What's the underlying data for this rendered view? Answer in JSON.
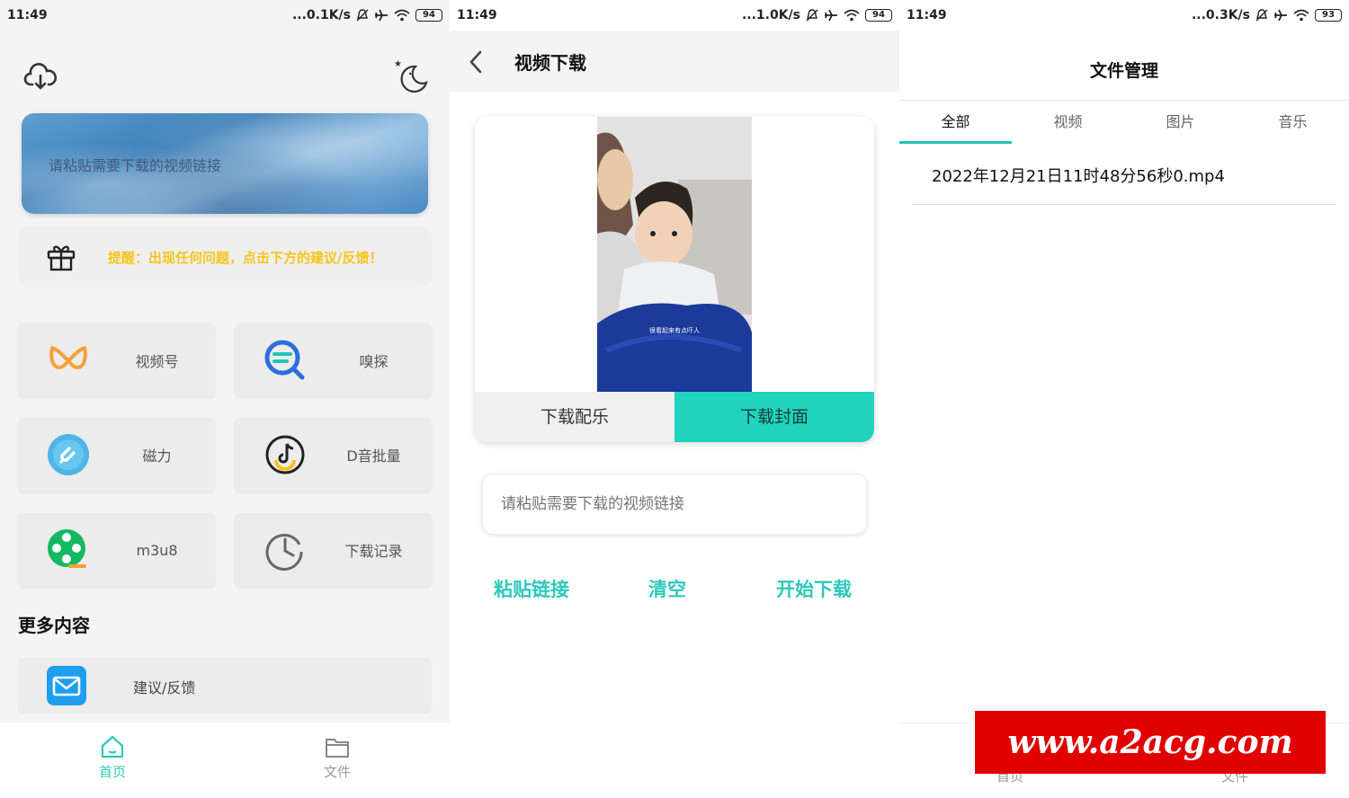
{
  "status": [
    {
      "time": "11:49",
      "speed": "...0.1K/s",
      "battery": "94"
    },
    {
      "time": "11:49",
      "speed": "...1.0K/s",
      "battery": "94"
    },
    {
      "time": "11:49",
      "speed": "...0.3K/s",
      "battery": "93"
    }
  ],
  "home": {
    "banner_placeholder": "请粘贴需要下载的视频链接",
    "tip": "提醒：出现任何问题，点击下方的建议/反馈！",
    "tiles": [
      {
        "label": "视频号",
        "icon": "wave-logo-icon"
      },
      {
        "label": "嗅探",
        "icon": "search-icon"
      },
      {
        "label": "磁力",
        "icon": "magnet-icon"
      },
      {
        "label": "D音批量",
        "icon": "music-note-icon"
      },
      {
        "label": "m3u8",
        "icon": "film-reel-icon"
      },
      {
        "label": "下载记录",
        "icon": "clock-icon"
      }
    ],
    "more_title": "更多内容",
    "feedback_label": "建议/反馈",
    "nav": {
      "home": "首页",
      "files": "文件"
    },
    "accent": "#2cc9bb",
    "tip_color": "#f5c518"
  },
  "download": {
    "title": "视频下载",
    "video_caption": "很看起来有点吓人",
    "download_music": "下载配乐",
    "download_cover": "下载封面",
    "input_placeholder": "请粘贴需要下载的视频链接",
    "paste": "粘贴链接",
    "clear": "清空",
    "start": "开始下载",
    "cover_color": "#20d4c0"
  },
  "files": {
    "title": "文件管理",
    "tabs": [
      "全部",
      "视频",
      "图片",
      "音乐"
    ],
    "active_tab": "全部",
    "items": [
      "2022年12月21日11时48分56秒0.mp4"
    ],
    "nav": {
      "home": "首页",
      "files": "文件"
    },
    "watermark": "www.a2acg.com"
  }
}
